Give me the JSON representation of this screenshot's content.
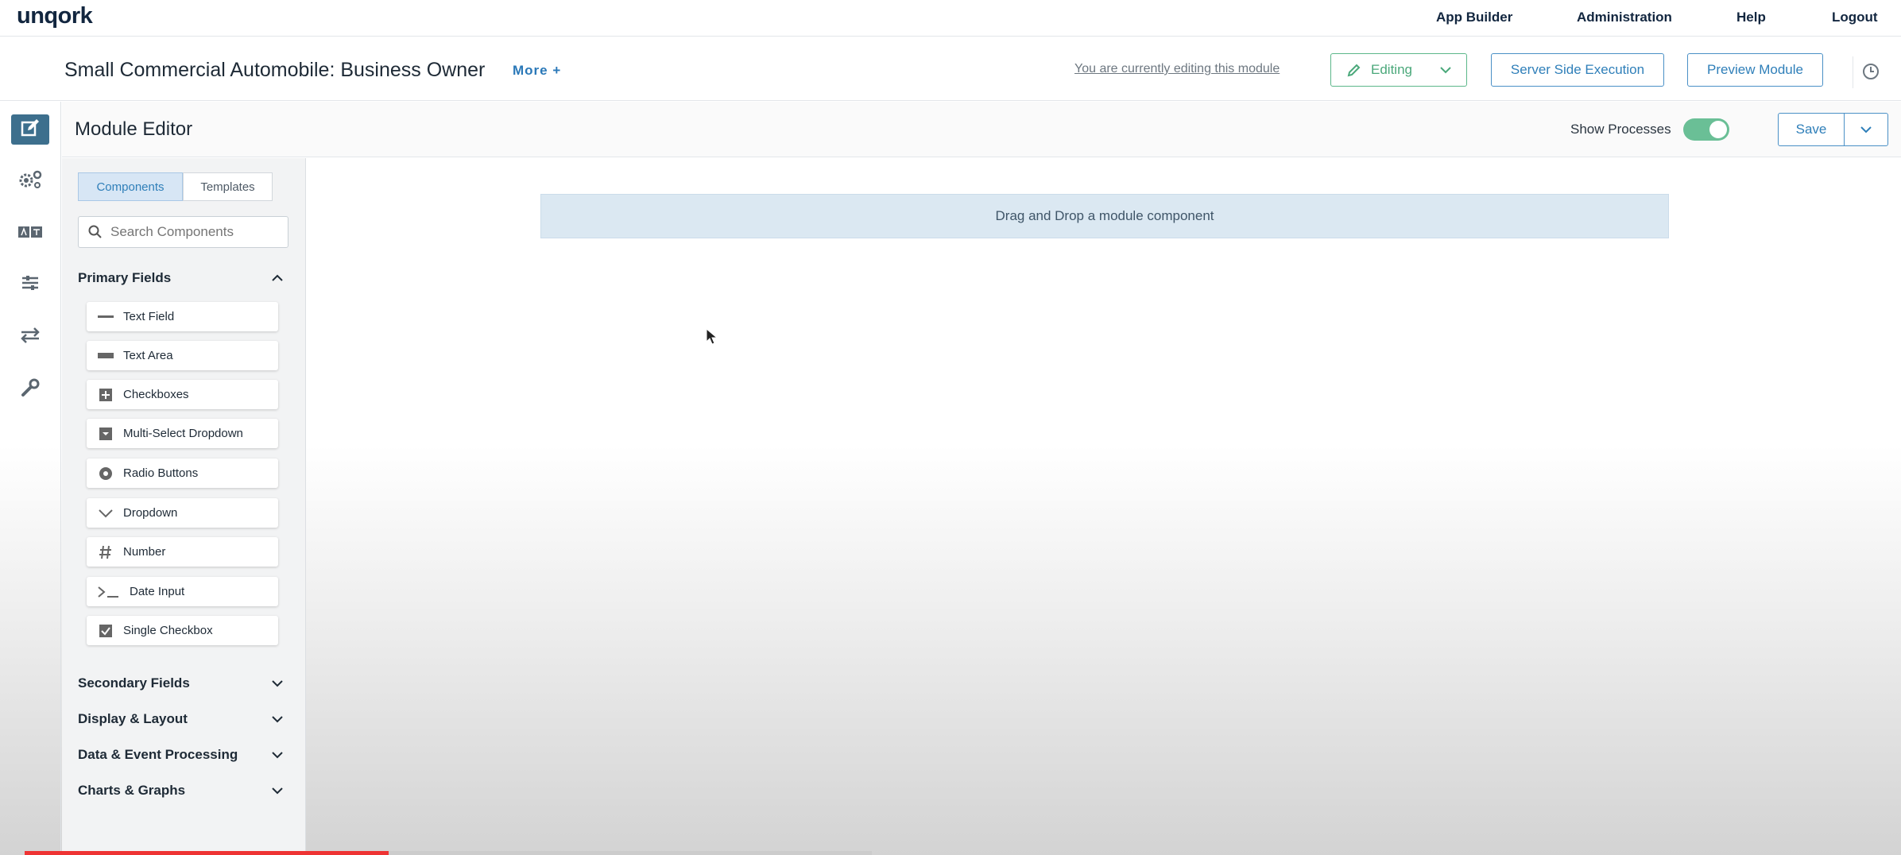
{
  "app": {
    "logo": "unqork"
  },
  "topnav": {
    "items": [
      "App Builder",
      "Administration",
      "Help",
      "Logout"
    ]
  },
  "module": {
    "title": "Small Commercial Automobile: Business Owner",
    "more": "More +",
    "editing_note": "You are currently editing this module",
    "editing_label": "Editing",
    "server_side": "Server Side Execution",
    "preview": "Preview Module"
  },
  "editor": {
    "title": "Module Editor",
    "show_processes": "Show Processes",
    "show_processes_on": true,
    "save": "Save"
  },
  "sidebar": {
    "tabs": [
      "Components",
      "Templates"
    ],
    "active_tab": "Components",
    "search_placeholder": "Search Components",
    "primary_title": "Primary Fields",
    "primary_items": [
      {
        "label": "Text Field",
        "icon": "text-field-icon"
      },
      {
        "label": "Text Area",
        "icon": "text-area-icon"
      },
      {
        "label": "Checkboxes",
        "icon": "checkboxes-icon"
      },
      {
        "label": "Multi-Select Dropdown",
        "icon": "multi-select-icon"
      },
      {
        "label": "Radio Buttons",
        "icon": "radio-icon"
      },
      {
        "label": "Dropdown",
        "icon": "dropdown-icon"
      },
      {
        "label": "Number",
        "icon": "hash-icon"
      },
      {
        "label": "Date Input",
        "icon": "terminal-icon"
      },
      {
        "label": "Single Checkbox",
        "icon": "checkbox-icon"
      }
    ],
    "sections": [
      "Secondary Fields",
      "Display & Layout",
      "Data & Event Processing",
      "Charts & Graphs"
    ]
  },
  "canvas": {
    "dropzone": "Drag and Drop a module component"
  },
  "colors": {
    "accent": "#2f7fb9",
    "rail_active": "#3d6f8d",
    "toggle_on": "#6abf96",
    "progress": "#ee3333"
  },
  "video_progress": 0.43
}
